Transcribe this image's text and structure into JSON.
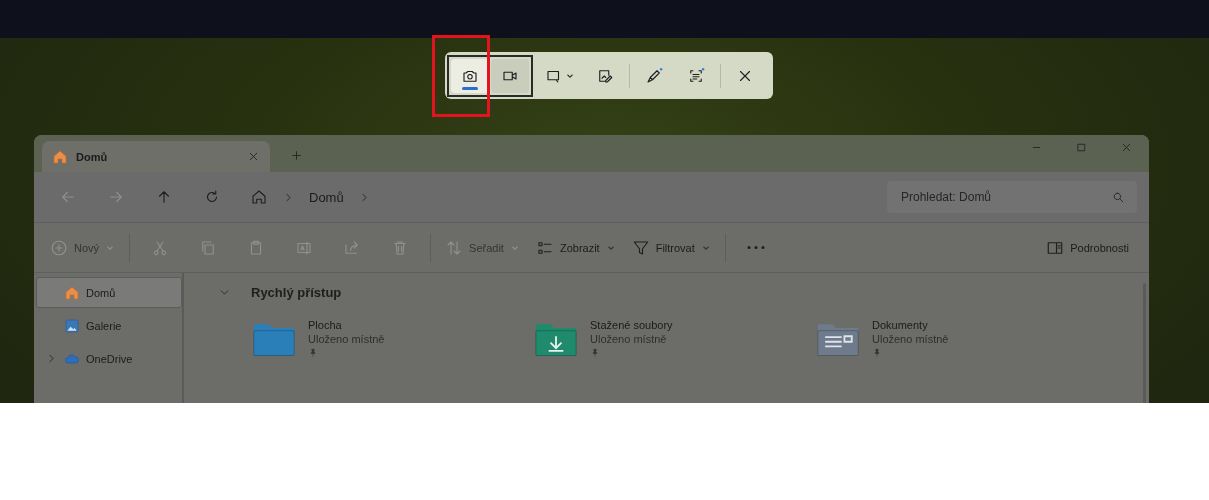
{
  "snip_toolbar": {
    "modes": [
      {
        "kind": "photo",
        "selected": true,
        "highlighted": true
      },
      {
        "kind": "video",
        "selected": false
      }
    ],
    "tools": [
      {
        "kind": "shape"
      },
      {
        "kind": "edit"
      },
      {
        "kind": "pen"
      },
      {
        "kind": "text"
      },
      {
        "kind": "close"
      }
    ]
  },
  "explorer": {
    "tabs": [
      {
        "label": "Domů",
        "selected": true
      }
    ],
    "nav": [
      {
        "kind": "back",
        "disabled": true
      },
      {
        "kind": "forward",
        "disabled": true
      },
      {
        "kind": "up",
        "disabled": false
      },
      {
        "kind": "refresh",
        "disabled": false
      }
    ],
    "address": {
      "crumbs": [
        "Domů"
      ]
    },
    "search": {
      "placeholder": "Prohledat: Domů"
    },
    "commands": [
      {
        "kind": "new",
        "label": "Nový",
        "disabled": true
      },
      {
        "kind": "cut",
        "disabled": true
      },
      {
        "kind": "copy",
        "disabled": true
      },
      {
        "kind": "paste",
        "disabled": true
      },
      {
        "kind": "rename",
        "disabled": true
      },
      {
        "kind": "share",
        "disabled": true
      },
      {
        "kind": "delete",
        "disabled": true
      },
      {
        "kind": "sort",
        "label": "Seřadit",
        "disabled": true
      },
      {
        "kind": "view",
        "label": "Zobrazit",
        "disabled": false
      },
      {
        "kind": "filter",
        "label": "Filtrovat",
        "disabled": false
      },
      {
        "kind": "more",
        "disabled": false
      }
    ],
    "details": {
      "label": "Podrobnosti"
    },
    "sidebar": [
      {
        "kind": "home",
        "label": "Domů",
        "selected": true
      },
      {
        "kind": "gallery",
        "label": "Galerie",
        "selected": false
      },
      {
        "kind": "cloud",
        "label": "OneDrive",
        "selected": false,
        "expanded": false
      }
    ],
    "section": {
      "title": "Rychlý přístup",
      "expanded": true,
      "items": [
        {
          "kind": "desktop",
          "name": "Plocha",
          "status": "Uloženo místně",
          "pinned": true
        },
        {
          "kind": "downloads",
          "name": "Stažené soubory",
          "status": "Uloženo místně",
          "pinned": true
        },
        {
          "kind": "documents",
          "name": "Dokumenty",
          "status": "Uloženo místně",
          "pinned": true
        }
      ]
    }
  }
}
